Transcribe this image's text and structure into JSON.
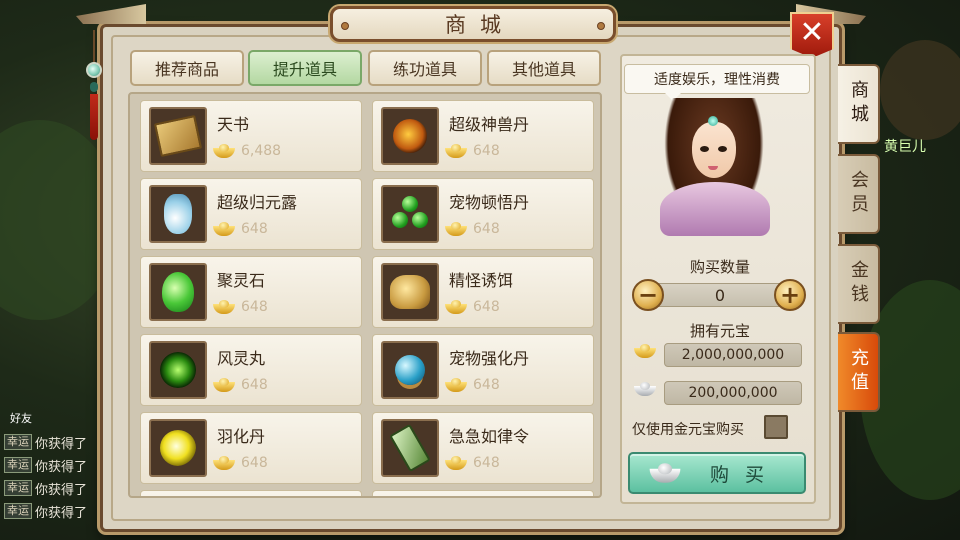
{
  "title": "商城",
  "background": {
    "npc_name": "黄巨儿",
    "chat": {
      "friend_label": "好友",
      "rows": [
        {
          "tag": "幸运",
          "text": "你获得了"
        },
        {
          "tag": "幸运",
          "text": "你获得了"
        },
        {
          "tag": "幸运",
          "text": "你获得了"
        },
        {
          "tag": "幸运",
          "text": "你获得了"
        }
      ]
    }
  },
  "category_tabs": [
    {
      "label": "推荐商品",
      "active": false
    },
    {
      "label": "提升道具",
      "active": true
    },
    {
      "label": "练功道具",
      "active": false
    },
    {
      "label": "其他道具",
      "active": false
    }
  ],
  "items": [
    {
      "name": "天书",
      "price": "6,488",
      "icon": "book-icon"
    },
    {
      "name": "超级神兽丹",
      "price": "648",
      "icon": "beast-pill-icon"
    },
    {
      "name": "超级归元露",
      "price": "648",
      "icon": "bottle-icon"
    },
    {
      "name": "宠物顿悟丹",
      "price": "648",
      "icon": "green-pills-icon"
    },
    {
      "name": "聚灵石",
      "price": "648",
      "icon": "spirit-stone-icon"
    },
    {
      "name": "精怪诱饵",
      "price": "648",
      "icon": "bait-bag-icon"
    },
    {
      "name": "风灵丸",
      "price": "648",
      "icon": "wind-pill-icon"
    },
    {
      "name": "宠物强化丹",
      "price": "648",
      "icon": "blue-pill-icon"
    },
    {
      "name": "羽化丹",
      "price": "648",
      "icon": "yellow-pill-icon"
    },
    {
      "name": "急急如律令",
      "price": "648",
      "icon": "talisman-icon"
    }
  ],
  "side_panel": {
    "speech": "适度娱乐，理性消费",
    "quantity_label": "购买数量",
    "quantity_value": "0",
    "owned_label": "拥有元宝",
    "gold_ingots": "2,000,000,000",
    "silver_ingots": "200,000,000",
    "gold_only_label": "仅使用金元宝购买",
    "buy_label": "购买"
  },
  "side_tabs": [
    {
      "label": "商城",
      "state": "active"
    },
    {
      "label": "会员",
      "state": "normal"
    },
    {
      "label": "金钱",
      "state": "normal"
    },
    {
      "label": "充值",
      "state": "charge"
    }
  ],
  "colors": {
    "active_tab": "#b4d8a2",
    "buy_button": "#5cc0a0",
    "charge_tab": "#e0600f",
    "close_button": "#c02a1a"
  }
}
